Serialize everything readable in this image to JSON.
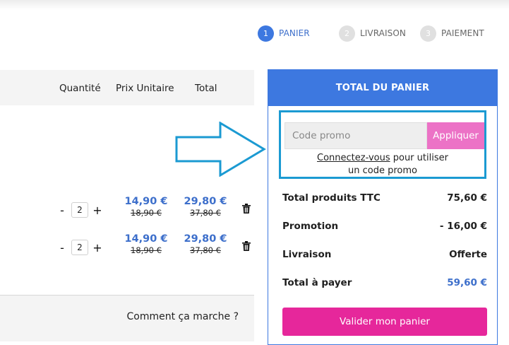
{
  "steps": [
    {
      "num": "1",
      "label": "PANIER"
    },
    {
      "num": "2",
      "label": "LIVRAISON"
    },
    {
      "num": "3",
      "label": "PAIEMENT"
    }
  ],
  "table": {
    "headers": {
      "quantity": "Quantité",
      "unit_price": "Prix Unitaire",
      "total": "Total"
    }
  },
  "products": [
    {
      "quantity": "2",
      "unit_price": "14,90 €",
      "unit_price_old": "18,90 €",
      "total": "29,80 €",
      "total_old": "37,80 €"
    },
    {
      "quantity": "2",
      "unit_price": "14,90 €",
      "unit_price_old": "18,90 €",
      "total": "29,80 €",
      "total_old": "37,80 €"
    }
  ],
  "qty_controls": {
    "minus": "-",
    "plus": "+"
  },
  "howto": {
    "label": "Comment ça marche ?"
  },
  "cart": {
    "title": "TOTAL DU PANIER",
    "promo": {
      "placeholder": "Code promo",
      "apply": "Appliquer",
      "login_link": "Connectez-vous",
      "login_rest": " pour utiliser",
      "line2": "un code promo"
    },
    "summary": [
      {
        "label": "Total produits TTC",
        "value": "75,60 €"
      },
      {
        "label": "Promotion",
        "value": "- 16,00 €"
      },
      {
        "label": "Livraison",
        "value": "Offerte"
      },
      {
        "label": "Total à payer",
        "value": "59,60 €"
      }
    ],
    "validate": "Valider mon panier"
  },
  "colors": {
    "accent_blue": "#3d78e0",
    "promo_pink": "#ec72c6",
    "validate_pink": "#e6279b",
    "callout": "#1b9ad2"
  }
}
